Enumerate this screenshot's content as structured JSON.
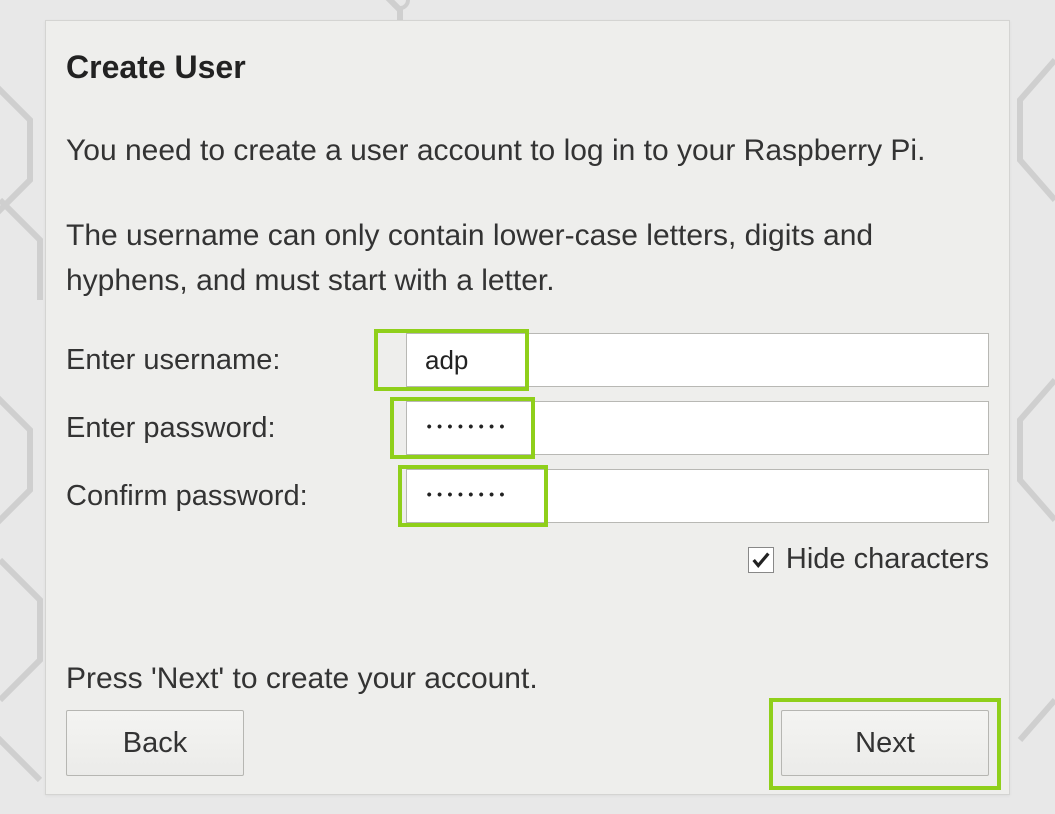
{
  "dialog": {
    "title": "Create User",
    "description": "You need to create a user account to log in to your Raspberry Pi.",
    "hint": "The username can only contain lower-case letters, digits and hyphens, and must start with a letter.",
    "footer": "Press 'Next' to create your account."
  },
  "form": {
    "username": {
      "label": "Enter username:",
      "value": "adp"
    },
    "password": {
      "label": "Enter password:",
      "value": "••••••••"
    },
    "confirm": {
      "label": "Confirm password:",
      "value": "••••••••"
    },
    "hide_characters": {
      "label": "Hide characters",
      "checked": true
    }
  },
  "buttons": {
    "back": "Back",
    "next": "Next"
  },
  "colors": {
    "highlight": "#8fcf1a",
    "dialog_bg": "#eeeeec"
  }
}
